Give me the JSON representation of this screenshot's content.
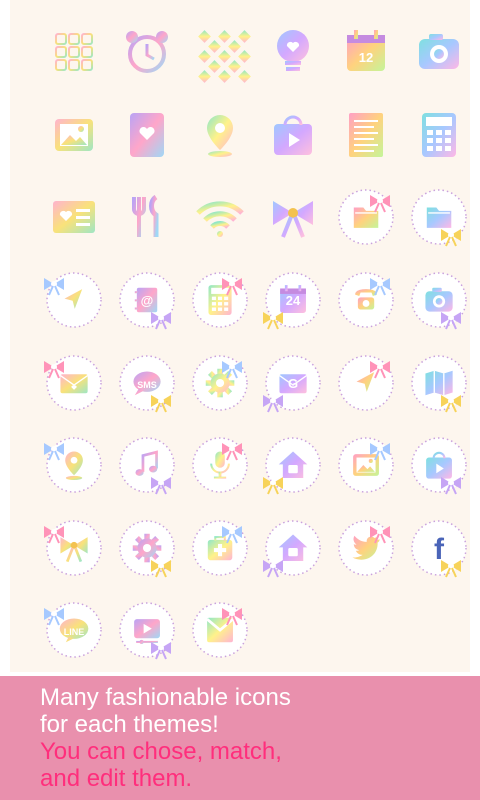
{
  "colors": {
    "panel_bg": "#fdf6ee",
    "banner_bg": "#e990ad",
    "banner_text": "#ffffff",
    "banner_accent": "#ff2e7c",
    "ring": "#c9a1dd"
  },
  "icons": [
    {
      "name": "app-grid-icon",
      "style": "square"
    },
    {
      "name": "alarm-clock-icon",
      "style": "square"
    },
    {
      "name": "diamond-pattern-icon",
      "style": "square"
    },
    {
      "name": "heart-bulb-icon",
      "style": "square"
    },
    {
      "name": "calendar-icon",
      "style": "square",
      "text": "12"
    },
    {
      "name": "camera-icon",
      "style": "square"
    },
    {
      "name": "gallery-icon",
      "style": "square"
    },
    {
      "name": "heart-card-icon",
      "style": "square"
    },
    {
      "name": "map-pin-icon",
      "style": "square"
    },
    {
      "name": "play-bag-icon",
      "style": "square"
    },
    {
      "name": "document-icon",
      "style": "square"
    },
    {
      "name": "calculator-icon",
      "style": "square"
    },
    {
      "name": "contact-list-icon",
      "style": "square"
    },
    {
      "name": "fork-knife-icon",
      "style": "square"
    },
    {
      "name": "wifi-icon",
      "style": "square"
    },
    {
      "name": "ribbon-bow-icon",
      "style": "square"
    },
    {
      "name": "folder-bow-icon",
      "style": "ring",
      "bow": true
    },
    {
      "name": "folder-bow-alt-icon",
      "style": "ring",
      "bow": true
    },
    {
      "name": "compass-browser-icon",
      "style": "ring",
      "bow": true
    },
    {
      "name": "at-contacts-icon",
      "style": "ring",
      "bow": true,
      "text": "@"
    },
    {
      "name": "calculator-ring-icon",
      "style": "ring",
      "bow": true
    },
    {
      "name": "calendar-ring-icon",
      "style": "ring",
      "bow": true,
      "text": "24"
    },
    {
      "name": "phone-icon",
      "style": "ring",
      "bow": true
    },
    {
      "name": "camera-ring-icon",
      "style": "ring",
      "bow": true
    },
    {
      "name": "heart-mail-icon",
      "style": "ring",
      "bow": true
    },
    {
      "name": "sms-bubble-icon",
      "style": "ring",
      "bow": true,
      "text": "SMS"
    },
    {
      "name": "settings-gear-icon",
      "style": "ring",
      "bow": true
    },
    {
      "name": "gmail-envelope-icon",
      "style": "ring",
      "bow": true,
      "text": "G"
    },
    {
      "name": "navigation-arrow-icon",
      "style": "ring",
      "bow": true
    },
    {
      "name": "folded-map-icon",
      "style": "ring",
      "bow": true
    },
    {
      "name": "location-pin-icon",
      "style": "ring",
      "bow": true
    },
    {
      "name": "music-note-icon",
      "style": "ring",
      "bow": true
    },
    {
      "name": "microphone-icon",
      "style": "ring",
      "bow": true
    },
    {
      "name": "home-icon",
      "style": "ring",
      "bow": true
    },
    {
      "name": "photo-icon",
      "style": "ring",
      "bow": true
    },
    {
      "name": "play-store-icon",
      "style": "ring",
      "bow": true
    },
    {
      "name": "ribbon-ring-icon",
      "style": "ring",
      "bow": true
    },
    {
      "name": "settings-ring-icon",
      "style": "ring",
      "bow": true
    },
    {
      "name": "medical-kit-icon",
      "style": "ring",
      "bow": true
    },
    {
      "name": "home-refresh-icon",
      "style": "ring",
      "bow": true
    },
    {
      "name": "twitter-bird-icon",
      "style": "ring",
      "bow": true
    },
    {
      "name": "facebook-icon",
      "style": "ring",
      "bow": true,
      "text": "f"
    },
    {
      "name": "line-chat-icon",
      "style": "ring",
      "bow": true,
      "text": "LINE"
    },
    {
      "name": "video-player-icon",
      "style": "ring",
      "bow": true
    },
    {
      "name": "gmail-box-icon",
      "style": "ring",
      "bow": true
    }
  ],
  "banner": {
    "line1": "Many fashionable icons",
    "line2": "for each themes!",
    "line3": "You can chose, match,",
    "line4": "and edit them."
  }
}
